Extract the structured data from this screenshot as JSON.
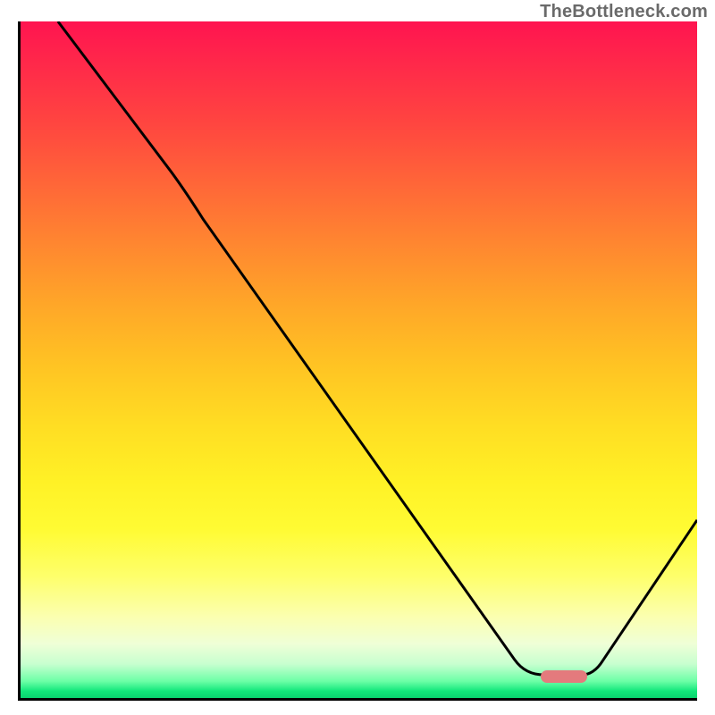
{
  "watermark": "TheBottleneck.com",
  "colors": {
    "gradient_top": "#ff1450",
    "gradient_mid": "#ffde23",
    "gradient_bottom": "#0ad36f",
    "curve": "#000000",
    "marker": "#e47a7d",
    "axis": "#000000"
  },
  "chart_data": {
    "type": "line",
    "title": "",
    "xlabel": "",
    "ylabel": "",
    "xlim": [
      0,
      100
    ],
    "ylim": [
      0,
      100
    ],
    "grid": false,
    "legend": false,
    "x": [
      5.5,
      22,
      73,
      77,
      83,
      100
    ],
    "y": [
      100,
      78,
      3.5,
      3.5,
      3.5,
      26
    ],
    "marker": {
      "x_start": 77,
      "x_end": 83,
      "y": 3.5
    },
    "background_scale": {
      "orientation": "vertical",
      "meaning": "bottleneck severity (top=high, bottom=low)",
      "stops": [
        {
          "pos": 0.0,
          "color": "#ff1450"
        },
        {
          "pos": 0.5,
          "color": "#ffde23"
        },
        {
          "pos": 0.95,
          "color": "#c7ffcf"
        },
        {
          "pos": 1.0,
          "color": "#0ad36f"
        }
      ]
    }
  }
}
